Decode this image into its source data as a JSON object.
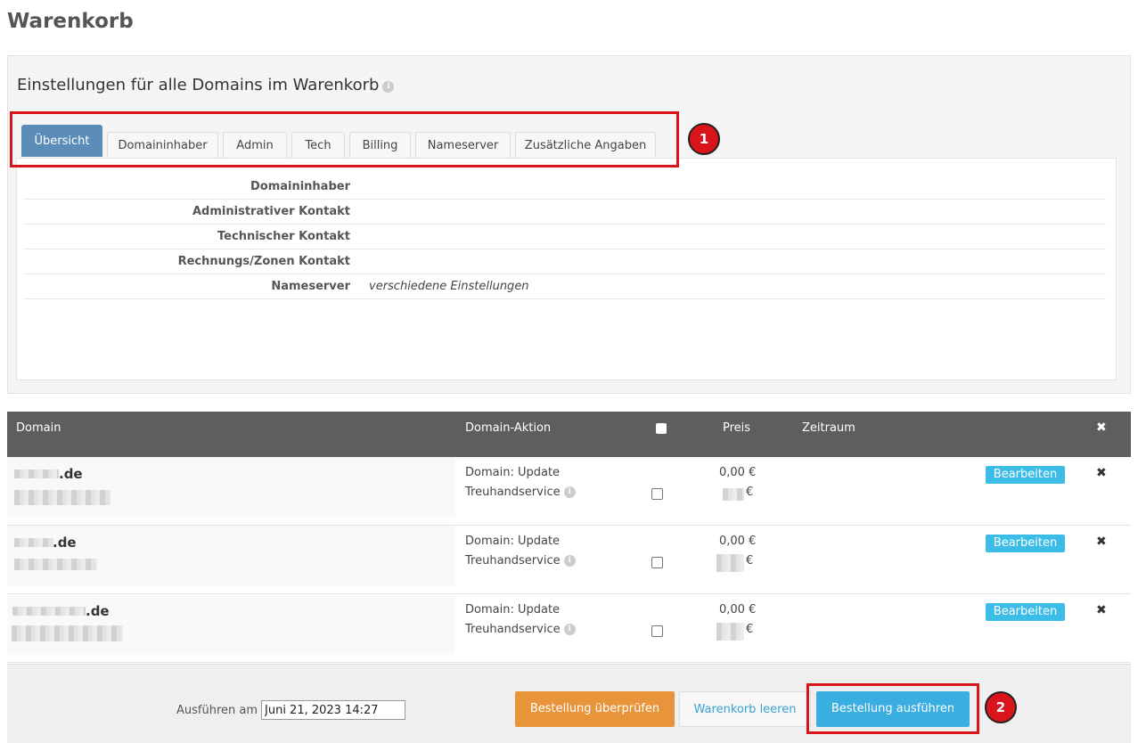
{
  "page": {
    "title": "Warenkorb"
  },
  "settings": {
    "heading": "Einstellungen für alle Domains im Warenkorb",
    "info_icon": "ℹ",
    "tabs": [
      "Übersicht",
      "Domaininhaber",
      "Admin",
      "Tech",
      "Billing",
      "Nameserver",
      "Zusätzliche Angaben"
    ],
    "active_tab": "Übersicht",
    "overview": [
      {
        "label": "Domaininhaber",
        "value": ""
      },
      {
        "label": "Administrativer Kontakt",
        "value": ""
      },
      {
        "label": "Technischer Kontakt",
        "value": ""
      },
      {
        "label": "Rechnungs/Zonen Kontakt",
        "value": ""
      },
      {
        "label": "Nameserver",
        "value": "verschiedene Einstellungen"
      }
    ]
  },
  "annotations": {
    "badge1": "1",
    "badge2": "2",
    "color": "#d9141b"
  },
  "table": {
    "headers": {
      "domain": "Domain",
      "action": "Domain-Aktion",
      "price": "Preis",
      "period": "Zeitraum",
      "remove_icon": "✖"
    },
    "rows": [
      {
        "domain_tld": ".de",
        "action_main": "Domain: Update",
        "action_sub": "Treuhandservice",
        "price": "0,00 €",
        "price_sub": "€",
        "edit_label": "Bearbeiten",
        "remove_icon": "✖"
      },
      {
        "domain_tld": ".de",
        "action_main": "Domain: Update",
        "action_sub": "Treuhandservice",
        "price": "0,00 €",
        "price_sub": "€",
        "edit_label": "Bearbeiten",
        "remove_icon": "✖"
      },
      {
        "domain_tld": ".de",
        "action_main": "Domain: Update",
        "action_sub": "Treuhandservice",
        "price": "0,00 €",
        "price_sub": "€",
        "edit_label": "Bearbeiten",
        "remove_icon": "✖"
      }
    ]
  },
  "footer": {
    "execute_label": "Ausführen am",
    "execute_value": "Juni 21, 2023 14:27",
    "check_button": "Bestellung überprüfen",
    "empty_button": "Warenkorb leeren",
    "order_button": "Bestellung ausführen"
  },
  "colors": {
    "tab_active": "#5b8db8",
    "header_bg": "#5e5e5e",
    "edit_button": "#3bbde8",
    "check_button": "#e8943a",
    "order_button": "#3aaee0"
  }
}
